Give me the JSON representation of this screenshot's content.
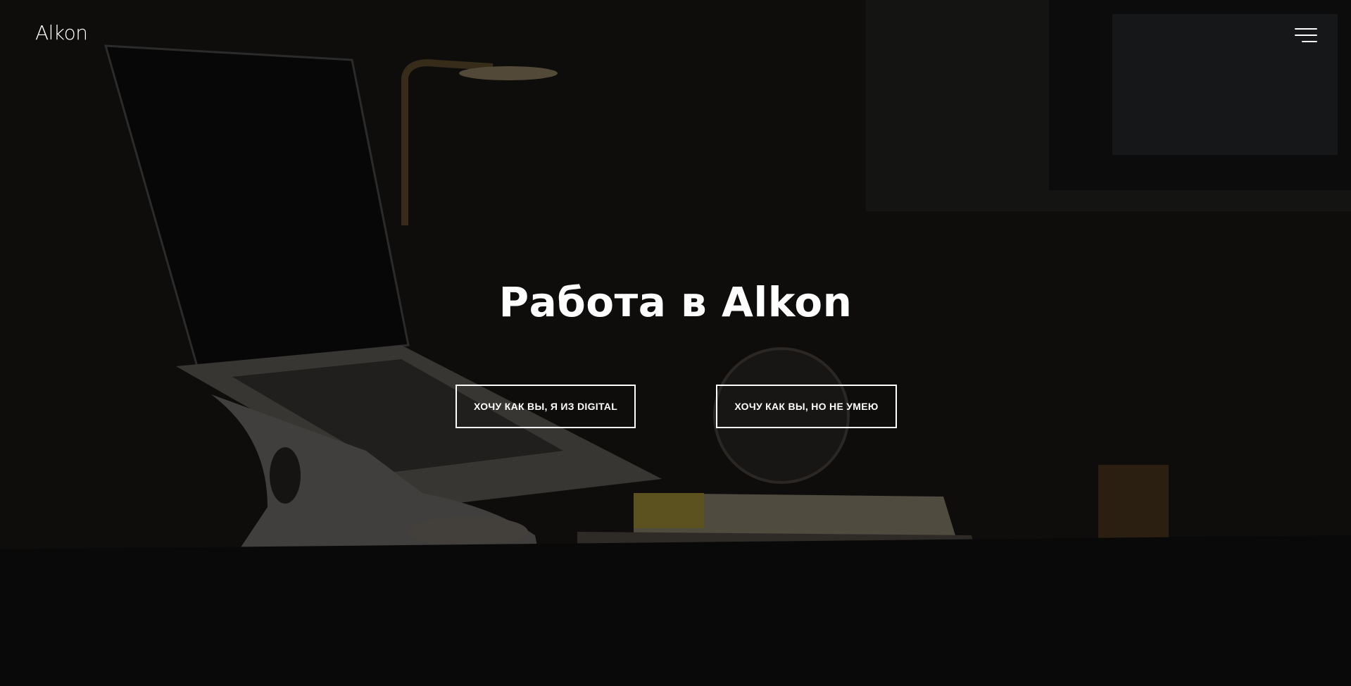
{
  "header": {
    "logo_text": "Alkon",
    "menu_icon": "hamburger-menu-icon"
  },
  "hero": {
    "title": "Работа в Alkon",
    "buttons": [
      {
        "label": "ХОЧУ КАК ВЫ, Я ИЗ DIGITAL"
      },
      {
        "label": "ХОЧУ КАК ВЫ, НО НЕ УМЕЮ"
      }
    ]
  },
  "colors": {
    "text": "#ffffff",
    "background": "#121110",
    "button_border": "#ffffff"
  }
}
